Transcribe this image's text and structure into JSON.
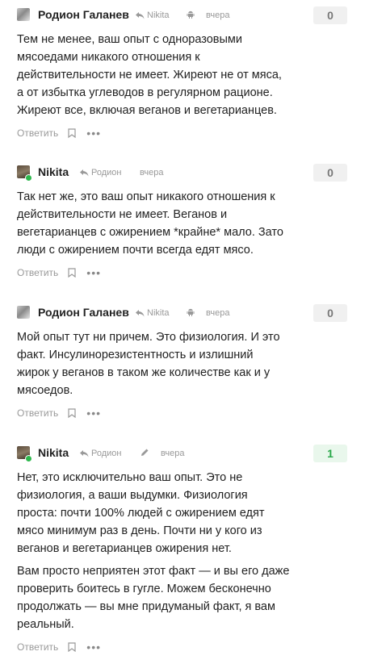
{
  "colors": {
    "online": "#2db84d",
    "positive_score": "#2aa84a",
    "meta": "#999999"
  },
  "icons": {
    "reply": "reply-arrow-icon",
    "android": "android-icon",
    "edit": "pencil-icon",
    "bookmark": "bookmark-icon",
    "more": "more-dots-icon"
  },
  "comments": [
    {
      "author": "Родион Галанев",
      "reply_to": "Nikita",
      "time": "вчера",
      "score": "0",
      "paragraphs": [
        "Тем не менее, ваш опыт с одноразовыми\nмясоедами никакого отношения к\nдействительности не имеет. Жиреют не от мяса,\nа от избытка углеводов в регулярном рационе.\nЖиреют все, включая веганов и вегетарианцев."
      ],
      "reply_label": "Ответить",
      "more_label": "•••"
    },
    {
      "author": "Nikita",
      "reply_to": "Родион",
      "time": "вчера",
      "score": "0",
      "paragraphs": [
        "Так нет же, это ваш опыт никакого отношения к\nдействительности не имеет. Веганов и\nвегетарианцев с ожирением *крайне* мало. Зато\nлюди с ожирением почти всегда едят мясо."
      ],
      "reply_label": "Ответить",
      "more_label": "•••"
    },
    {
      "author": "Родион Галанев",
      "reply_to": "Nikita",
      "time": "вчера",
      "score": "0",
      "paragraphs": [
        "Мой опыт тут ни причем. Это физиология. И это\nфакт. Инсулинорезистентность и излишний\nжирок у веганов в таком же количестве как и у\nмясоедов."
      ],
      "reply_label": "Ответить",
      "more_label": "•••"
    },
    {
      "author": "Nikita",
      "reply_to": "Родион",
      "time": "вчера",
      "score": "1",
      "paragraphs": [
        "Нет, это исключительно ваш опыт. Это не\nфизиология, а ваши выдумки. Физиология\nпроста: почти 100% людей с ожирением едят\nмясо минимум раз в день. Почти ни у кого из\nвеганов и вегетарианцев ожирения нет.",
        "Вам просто неприятен этот факт — и вы его даже\nпроверить боитесь в гугле. Можем бесконечно\nпродолжать — вы мне придуманый факт, я вам\nреальный."
      ],
      "reply_label": "Ответить",
      "more_label": "•••"
    }
  ]
}
